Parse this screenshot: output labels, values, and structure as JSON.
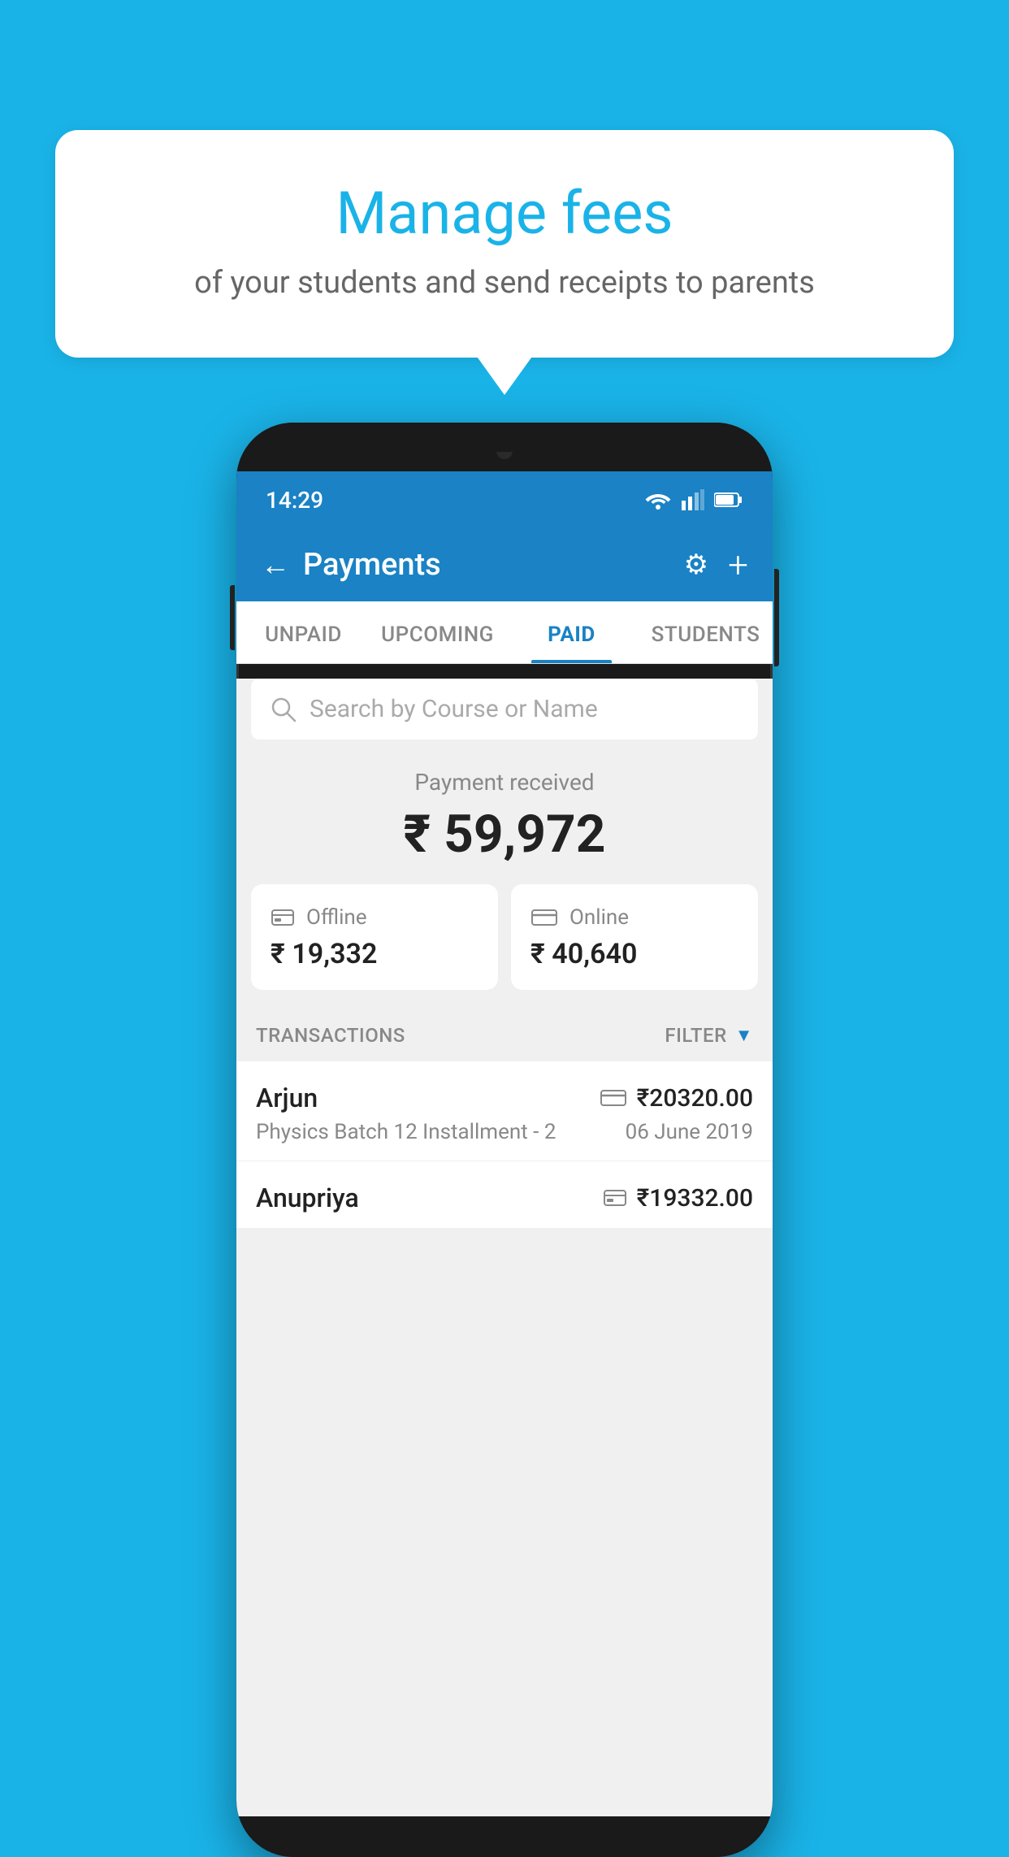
{
  "background_color": "#1ab3e8",
  "speech_bubble": {
    "title": "Manage fees",
    "subtitle": "of your students and send receipts to parents"
  },
  "status_bar": {
    "time": "14:29",
    "icons": [
      "wifi",
      "signal",
      "battery"
    ]
  },
  "app_header": {
    "title": "Payments",
    "back_label": "←",
    "settings_label": "⚙",
    "add_label": "+"
  },
  "tabs": [
    {
      "label": "UNPAID",
      "active": false
    },
    {
      "label": "UPCOMING",
      "active": false
    },
    {
      "label": "PAID",
      "active": true
    },
    {
      "label": "STUDENTS",
      "active": false
    }
  ],
  "search": {
    "placeholder": "Search by Course or Name"
  },
  "payment_summary": {
    "label": "Payment received",
    "amount": "₹ 59,972"
  },
  "payment_cards": [
    {
      "type": "Offline",
      "amount": "₹ 19,332",
      "icon": "💳"
    },
    {
      "type": "Online",
      "amount": "₹ 40,640",
      "icon": "💳"
    }
  ],
  "transactions_section": {
    "label": "TRANSACTIONS",
    "filter_label": "FILTER"
  },
  "transactions": [
    {
      "name": "Arjun",
      "course": "Physics Batch 12 Installment - 2",
      "amount": "₹20320.00",
      "date": "06 June 2019",
      "payment_type": "online"
    },
    {
      "name": "Anupriya",
      "course": "",
      "amount": "₹19332.00",
      "date": "",
      "payment_type": "offline"
    }
  ]
}
